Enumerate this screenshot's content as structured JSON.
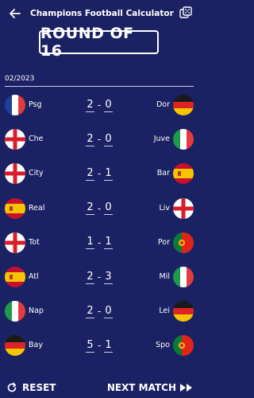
{
  "header": {
    "title": "Champions Football Calculator"
  },
  "round_title": "ROUND OF 16",
  "season": "02/2023",
  "matches": [
    {
      "home": "Psg",
      "home_flag": "france-flag-icon",
      "home_goals": "2",
      "away_goals": "0",
      "away": "Dor",
      "away_flag": "germany-flag-icon"
    },
    {
      "home": "Che",
      "home_flag": "england-flag-icon",
      "home_goals": "2",
      "away_goals": "0",
      "away": "Juve",
      "away_flag": "italy-flag-icon"
    },
    {
      "home": "City",
      "home_flag": "england-flag-icon",
      "home_goals": "2",
      "away_goals": "1",
      "away": "Bar",
      "away_flag": "spain-flag-icon"
    },
    {
      "home": "Real",
      "home_flag": "spain-flag-icon",
      "home_goals": "2",
      "away_goals": "0",
      "away": "Liv",
      "away_flag": "england-flag-icon"
    },
    {
      "home": "Tot",
      "home_flag": "england-flag-icon",
      "home_goals": "1",
      "away_goals": "1",
      "away": "Por",
      "away_flag": "portugal-flag-icon"
    },
    {
      "home": "Atl",
      "home_flag": "spain-flag-icon",
      "home_goals": "2",
      "away_goals": "3",
      "away": "Mil",
      "away_flag": "italy-flag-icon"
    },
    {
      "home": "Nap",
      "home_flag": "italy-flag-icon",
      "home_goals": "2",
      "away_goals": "0",
      "away": "Lei",
      "away_flag": "germany-flag-icon"
    },
    {
      "home": "Bay",
      "home_flag": "germany-flag-icon",
      "home_goals": "5",
      "away_goals": "1",
      "away": "Spo",
      "away_flag": "portugal-flag-icon"
    }
  ],
  "footer": {
    "reset_label": "RESET",
    "next_label": "NEXT MATCH"
  },
  "colors": {
    "background": "#1a2263",
    "text": "#ffffff",
    "divider": "#c9cbe6"
  }
}
